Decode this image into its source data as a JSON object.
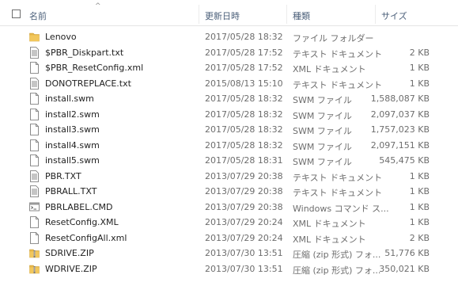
{
  "columns": {
    "name": "名前",
    "date": "更新日時",
    "type": "種類",
    "size": "サイズ"
  },
  "files": [
    {
      "name": "Lenovo",
      "date": "2017/05/28 18:32",
      "type": "ファイル フォルダー",
      "size": "",
      "icon": "folder-icon"
    },
    {
      "name": "$PBR_Diskpart.txt",
      "date": "2017/05/28 17:52",
      "type": "テキスト ドキュメント",
      "size": "2 KB",
      "icon": "text-file-icon"
    },
    {
      "name": "$PBR_ResetConfig.xml",
      "date": "2017/05/28 17:52",
      "type": "XML ドキュメント",
      "size": "1 KB",
      "icon": "xml-file-icon"
    },
    {
      "name": "DONOTREPLACE.txt",
      "date": "2015/08/13 15:10",
      "type": "テキスト ドキュメント",
      "size": "1 KB",
      "icon": "text-file-icon"
    },
    {
      "name": "install.swm",
      "date": "2017/05/28 18:32",
      "type": "SWM ファイル",
      "size": "1,588,087 KB",
      "icon": "blank-file-icon"
    },
    {
      "name": "install2.swm",
      "date": "2017/05/28 18:32",
      "type": "SWM ファイル",
      "size": "2,097,037 KB",
      "icon": "blank-file-icon"
    },
    {
      "name": "install3.swm",
      "date": "2017/05/28 18:32",
      "type": "SWM ファイル",
      "size": "1,757,023 KB",
      "icon": "blank-file-icon"
    },
    {
      "name": "install4.swm",
      "date": "2017/05/28 18:32",
      "type": "SWM ファイル",
      "size": "2,097,151 KB",
      "icon": "blank-file-icon"
    },
    {
      "name": "install5.swm",
      "date": "2017/05/28 18:31",
      "type": "SWM ファイル",
      "size": "545,475 KB",
      "icon": "blank-file-icon"
    },
    {
      "name": "PBR.TXT",
      "date": "2013/07/29 20:38",
      "type": "テキスト ドキュメント",
      "size": "1 KB",
      "icon": "text-file-icon"
    },
    {
      "name": "PBRALL.TXT",
      "date": "2013/07/29 20:38",
      "type": "テキスト ドキュメント",
      "size": "1 KB",
      "icon": "text-file-icon"
    },
    {
      "name": "PBRLABEL.CMD",
      "date": "2013/07/29 20:38",
      "type": "Windows コマンド ス...",
      "size": "1 KB",
      "icon": "cmd-file-icon"
    },
    {
      "name": "ResetConfig.XML",
      "date": "2013/07/29 20:24",
      "type": "XML ドキュメント",
      "size": "1 KB",
      "icon": "xml-file-icon"
    },
    {
      "name": "ResetConfigAll.xml",
      "date": "2013/07/29 20:24",
      "type": "XML ドキュメント",
      "size": "2 KB",
      "icon": "xml-file-icon"
    },
    {
      "name": "SDRIVE.ZIP",
      "date": "2013/07/30 13:51",
      "type": "圧縮 (zip 形式) フォ...",
      "size": "51,776 KB",
      "icon": "zip-folder-icon"
    },
    {
      "name": "WDRIVE.ZIP",
      "date": "2013/07/30 13:51",
      "type": "圧縮 (zip 形式) フォ...",
      "size": "350,021 KB",
      "icon": "zip-folder-icon"
    }
  ],
  "colors": {
    "header_text": "#4c607a",
    "secondary_text": "#6d6d6d",
    "folder": "#e8b84a",
    "zip": "#e8b84a"
  }
}
